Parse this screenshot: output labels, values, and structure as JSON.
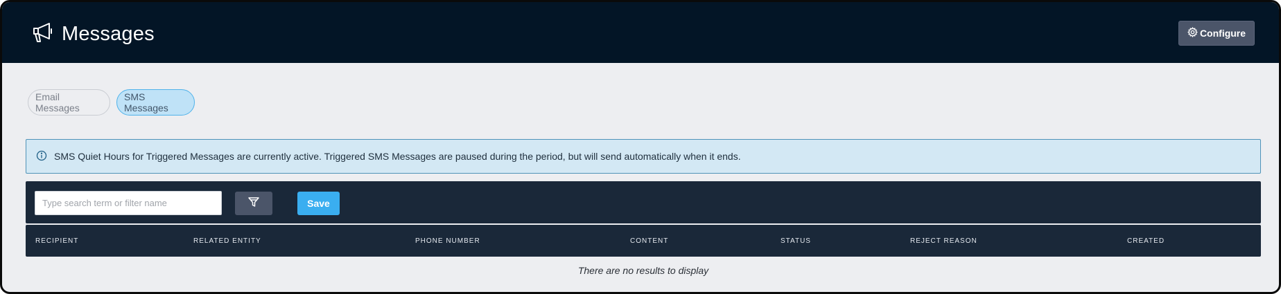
{
  "header": {
    "title": "Messages",
    "title_icon": "megaphone-icon",
    "configure_label": "Configure",
    "configure_icon": "gear-icon"
  },
  "tabs": [
    {
      "label": "Email Messages",
      "active": false
    },
    {
      "label": "SMS Messages",
      "active": true
    }
  ],
  "alert": {
    "icon": "info-icon",
    "text": "SMS Quiet Hours for Triggered Messages are currently active. Triggered SMS Messages are paused during the period, but will send automatically when it ends."
  },
  "toolbar": {
    "search_placeholder": "Type search term or filter name",
    "search_value": "",
    "filter_icon": "filter-icon",
    "save_label": "Save"
  },
  "table": {
    "columns": [
      "RECIPIENT",
      "RELATED ENTITY",
      "PHONE NUMBER",
      "CONTENT",
      "STATUS",
      "REJECT REASON",
      "CREATED"
    ],
    "rows": [],
    "empty_message": "There are no results to display"
  },
  "colors": {
    "header_bg": "#031526",
    "page_bg": "#edeef1",
    "accent": "#3aaef0",
    "alert_bg": "#d3e8f4",
    "toolbar_bg": "#1a2839"
  }
}
